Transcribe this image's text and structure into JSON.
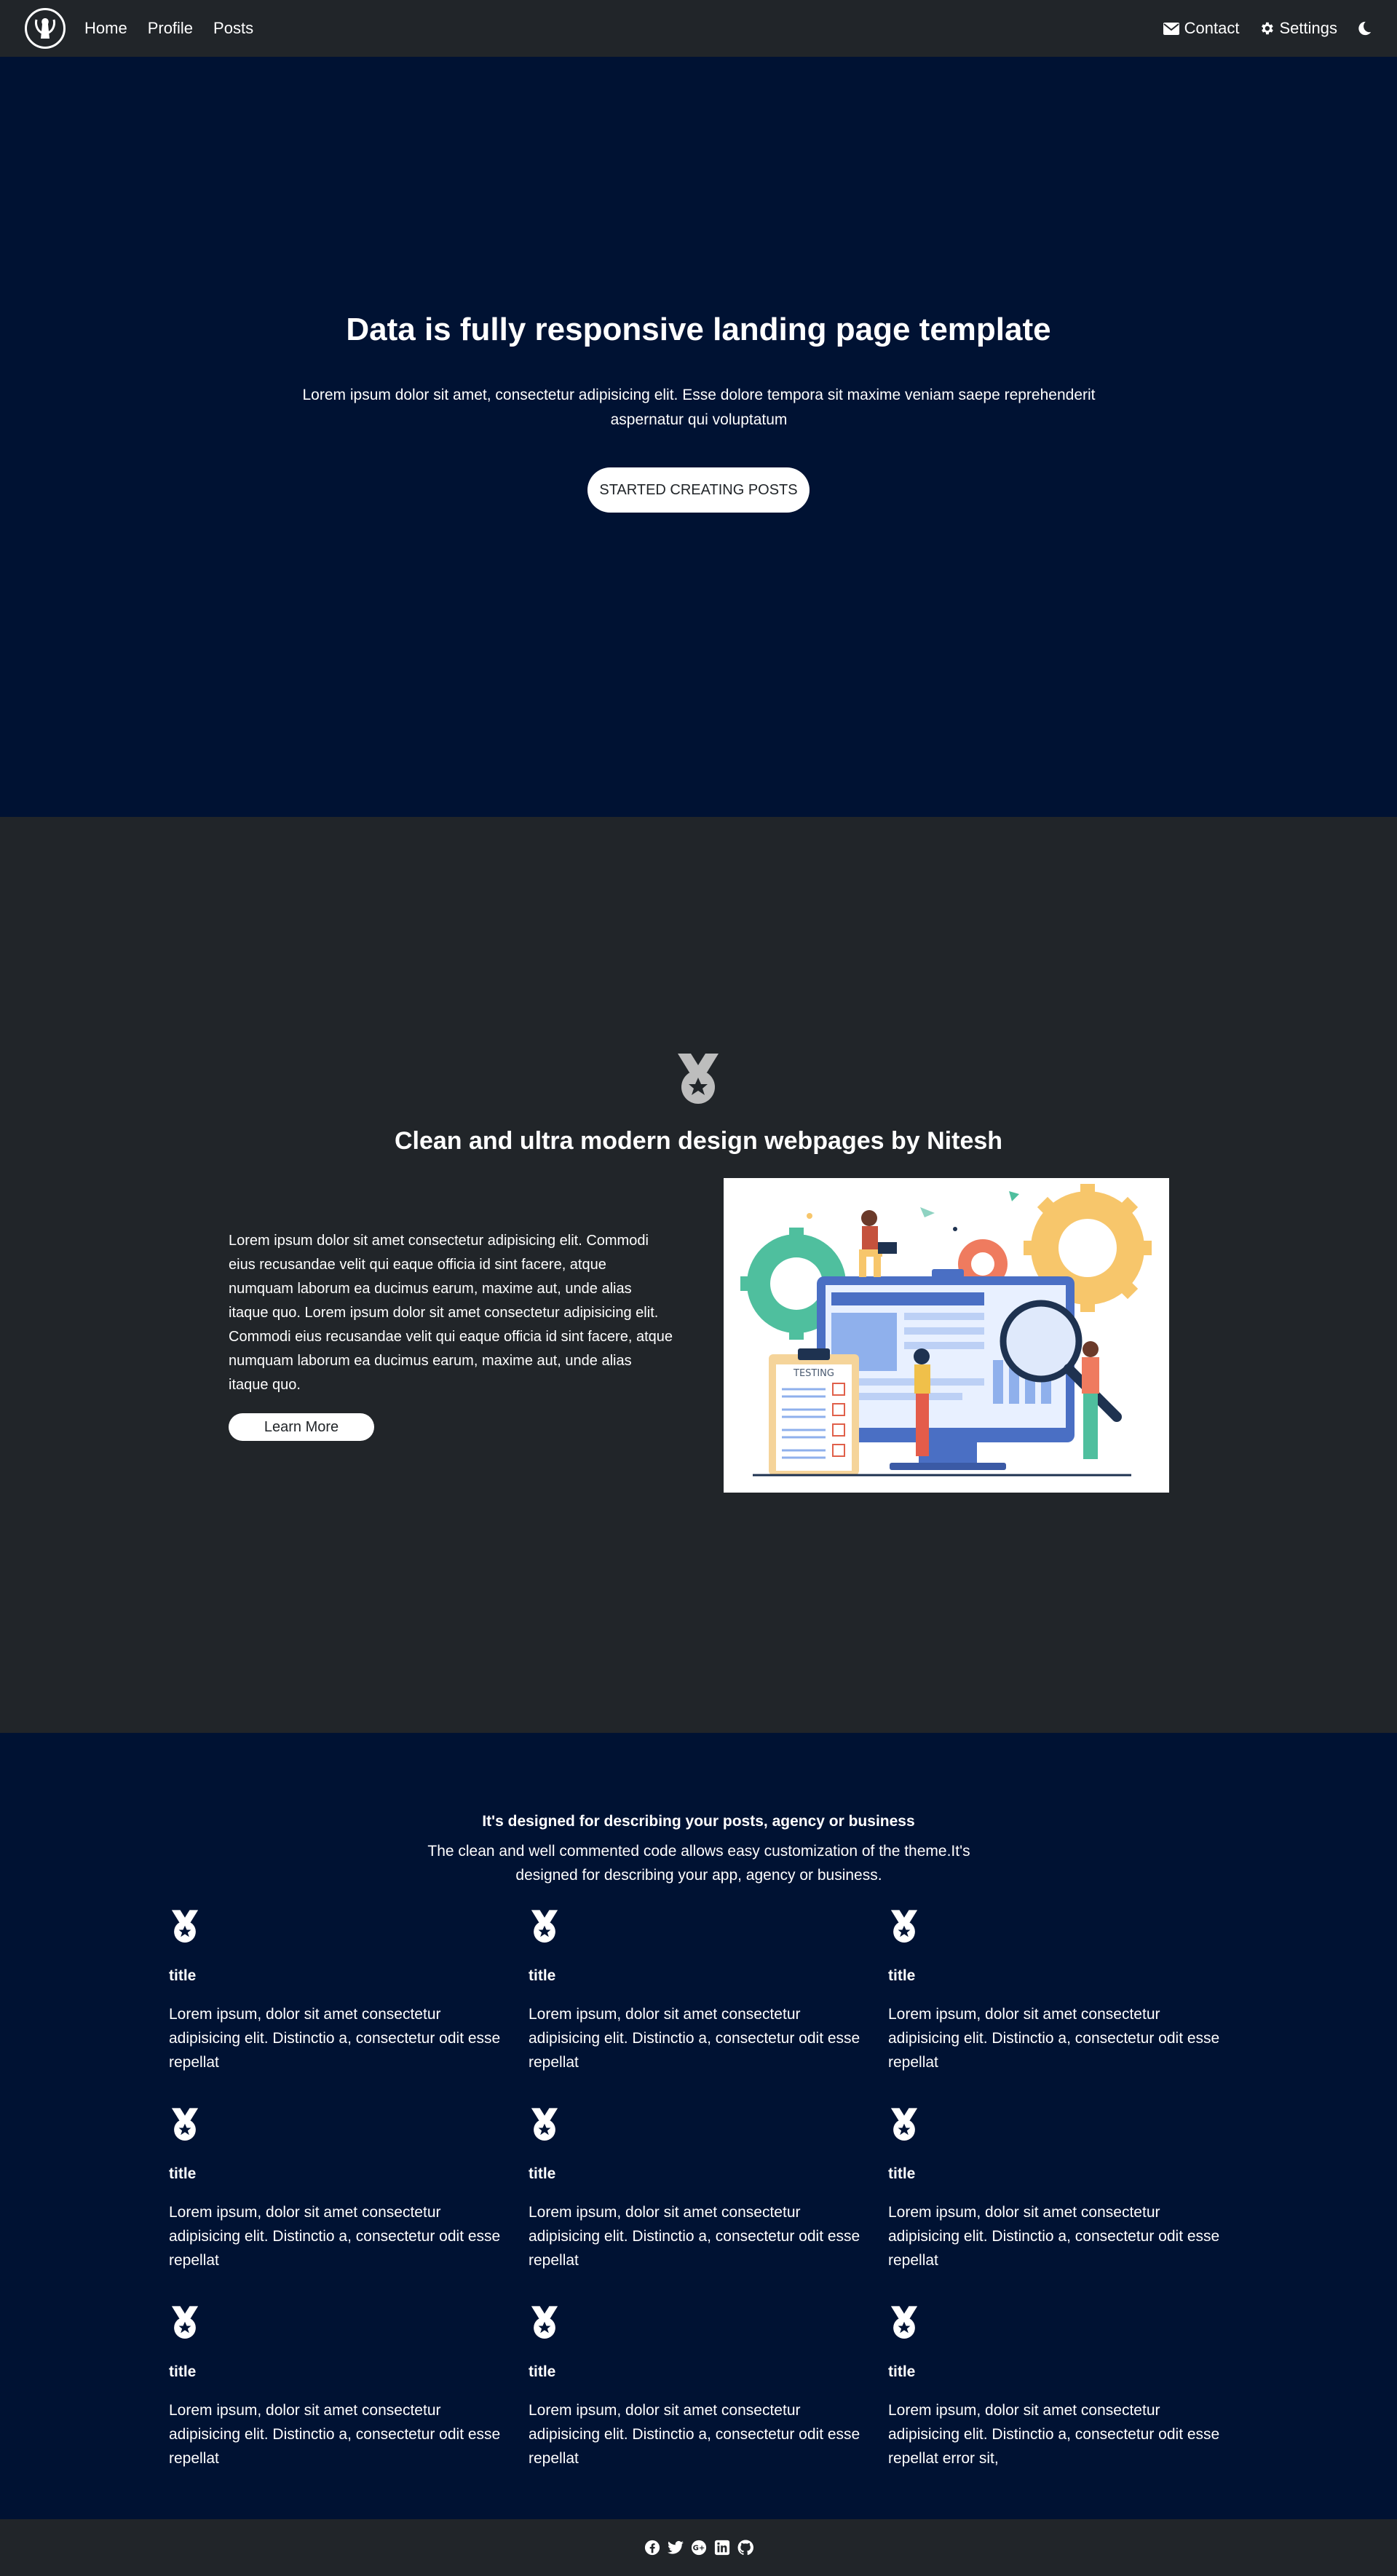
{
  "nav": {
    "links": [
      "Home",
      "Profile",
      "Posts"
    ],
    "contact": "Contact",
    "settings": "Settings"
  },
  "hero": {
    "title": "Data is fully responsive landing page template",
    "text": "Lorem ipsum dolor sit amet, consectetur adipisicing elit. Esse dolore tempora sit maxime veniam saepe reprehenderit aspernatur qui voluptatum",
    "button": "STARTED CREATING POSTS"
  },
  "feature": {
    "title": "Clean and ultra modern design webpages by Nitesh",
    "text": "Lorem ipsum dolor sit amet consectetur adipisicing elit. Commodi eius recusandae velit qui eaque officia id sint facere, atque numquam laborum ea ducimus earum, maxime aut, unde alias itaque quo. Lorem ipsum dolor sit amet consectetur adipisicing elit. Commodi eius recusandae velit qui eaque officia id sint facere, atque numquam laborum ea ducimus earum, maxime aut, unde alias itaque quo.",
    "button": "Learn More",
    "illustration_label": "TESTING"
  },
  "grid": {
    "title": "It's designed for describing your posts, agency or business",
    "subtitle": "The clean and well commented code allows easy customization of the theme.It's designed for describing your app, agency or business.",
    "cards": [
      {
        "title": "title",
        "text": "Lorem ipsum, dolor sit amet consectetur adipisicing elit. Distinctio a, consectetur odit esse repellat"
      },
      {
        "title": "title",
        "text": "Lorem ipsum, dolor sit amet consectetur adipisicing elit. Distinctio a, consectetur odit esse repellat"
      },
      {
        "title": "title",
        "text": "Lorem ipsum, dolor sit amet consectetur adipisicing elit. Distinctio a, consectetur odit esse repellat"
      },
      {
        "title": "title",
        "text": "Lorem ipsum, dolor sit amet consectetur adipisicing elit. Distinctio a, consectetur odit esse repellat"
      },
      {
        "title": "title",
        "text": "Lorem ipsum, dolor sit amet consectetur adipisicing elit. Distinctio a, consectetur odit esse repellat"
      },
      {
        "title": "title",
        "text": "Lorem ipsum, dolor sit amet consectetur adipisicing elit. Distinctio a, consectetur odit esse repellat"
      },
      {
        "title": "title",
        "text": "Lorem ipsum, dolor sit amet consectetur adipisicing elit. Distinctio a, consectetur odit esse repellat"
      },
      {
        "title": "title",
        "text": "Lorem ipsum, dolor sit amet consectetur adipisicing elit. Distinctio a, consectetur odit esse repellat"
      },
      {
        "title": "title",
        "text": "Lorem ipsum, dolor sit amet consectetur adipisicing elit. Distinctio a, consectetur odit esse repellat error sit,"
      }
    ]
  },
  "footer": {
    "icons": [
      "facebook-icon",
      "twitter-icon",
      "google-plus-icon",
      "linkedin-icon",
      "github-icon"
    ]
  },
  "colors": {
    "hero_bg": "#001233",
    "dark_bg": "#212529",
    "text": "#ffffff"
  }
}
